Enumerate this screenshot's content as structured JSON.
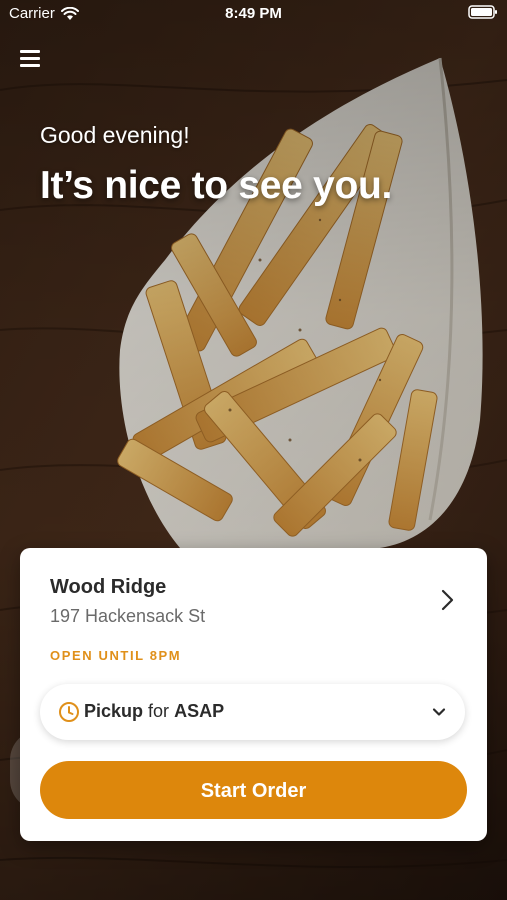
{
  "status_bar": {
    "carrier": "Carrier",
    "time": "8:49 PM"
  },
  "greeting": {
    "salutation": "Good evening!",
    "headline": "It’s nice to see you."
  },
  "store": {
    "name": "Wood Ridge",
    "address": "197 Hackensack St",
    "hours": "OPEN UNTIL 8PM"
  },
  "order_mode": {
    "mode": "Pickup",
    "connector": "for",
    "time": "ASAP"
  },
  "actions": {
    "start_order_label": "Start Order"
  },
  "colors": {
    "accent": "#dd870c",
    "hours_text": "#e0901a",
    "card_background": "#ffffff"
  },
  "icons": {
    "menu": "hamburger-menu-icon",
    "store_chevron": "chevron-right-icon",
    "clock": "clock-icon",
    "dropdown": "chevron-down-icon",
    "wifi": "wifi-icon",
    "battery": "battery-icon"
  }
}
